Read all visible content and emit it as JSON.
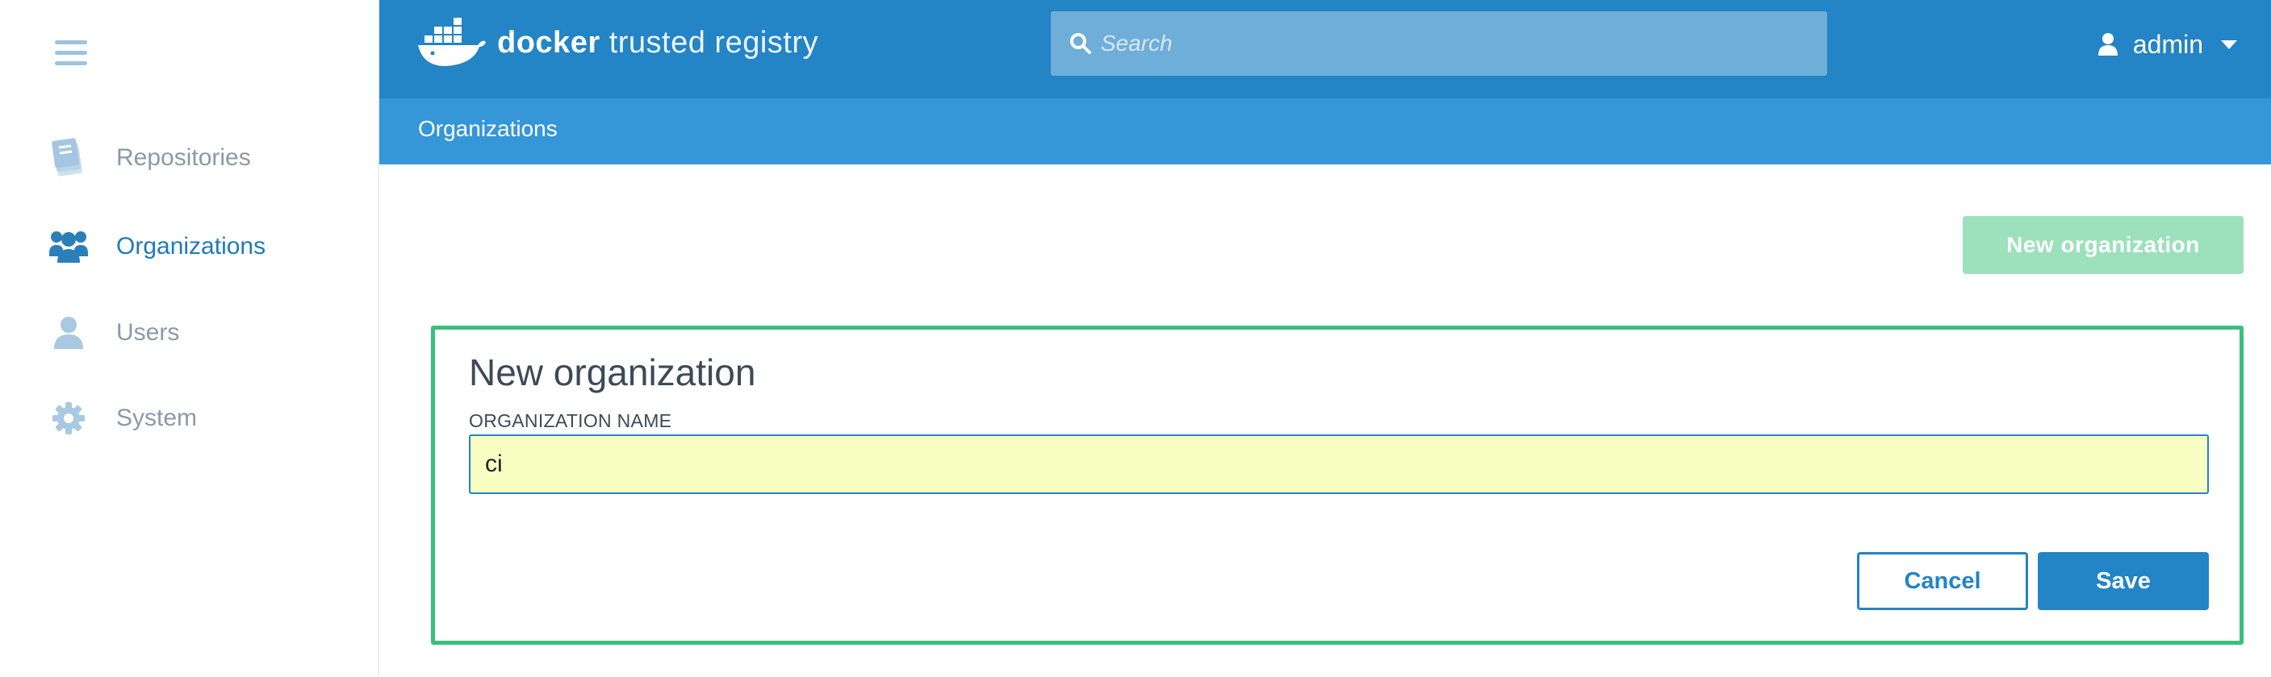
{
  "app": {
    "logo_word_bold": "docker",
    "logo_word_light": "trusted registry",
    "logo_icon": "docker-whale-icon"
  },
  "search": {
    "placeholder": "Search",
    "icon": "search-icon"
  },
  "user": {
    "name": "admin",
    "icon": "user-icon"
  },
  "sidebar": {
    "items": [
      {
        "label": "Repositories",
        "icon": "books-icon",
        "active": false
      },
      {
        "label": "Organizations",
        "icon": "group-icon",
        "active": true
      },
      {
        "label": "Users",
        "icon": "user-icon",
        "active": false
      },
      {
        "label": "System",
        "icon": "gear-icon",
        "active": false
      }
    ]
  },
  "breadcrumb": {
    "current": "Organizations"
  },
  "actions": {
    "new_org_label": "New organization"
  },
  "form": {
    "title": "New organization",
    "field_label": "ORGANIZATION NAME",
    "field_value": "ci",
    "cancel_label": "Cancel",
    "save_label": "Save"
  },
  "colors": {
    "topbar": "#2384c6",
    "subbar": "#3596d8",
    "accent_green": "#3abf7c",
    "new_org_button": "#9ce1bb",
    "input_highlight": "#f8fdc2",
    "active_nav": "#1f7ab8",
    "inactive_nav": "#8a9aa8"
  }
}
